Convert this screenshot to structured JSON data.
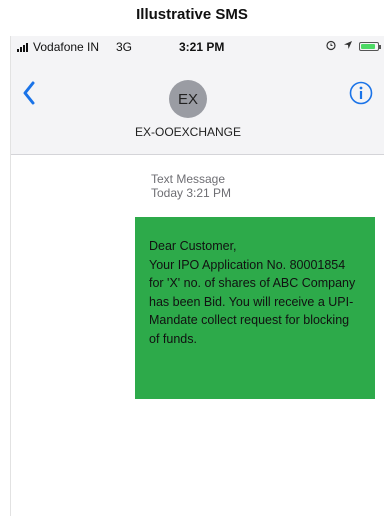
{
  "caption": "Illustrative SMS",
  "status_bar": {
    "carrier": "Vodafone IN",
    "network": "3G",
    "time": "3:21 PM",
    "battery_level": 0.85,
    "icons": [
      "signal-icon",
      "alarm-icon",
      "location-icon",
      "battery-icon"
    ]
  },
  "header": {
    "avatar_initials": "EX",
    "contact_name": "EX-OOEXCHANGE",
    "icons": [
      "back-chevron-icon",
      "info-icon"
    ]
  },
  "thread": {
    "message_type": "Text Message",
    "timestamp": "Today 3:21 PM",
    "message": {
      "lines": [
        "Dear Customer,",
        "Your IPO Application No. 80001854",
        "for 'X' no. of shares of ABC Company",
        "has been Bid. You will receive a UPI-",
        "Mandate collect request for blocking",
        "of funds."
      ]
    }
  },
  "colors": {
    "accent": "#1a73e8",
    "bubble": "#2daa4a",
    "header_bg": "#f4f4f6"
  }
}
